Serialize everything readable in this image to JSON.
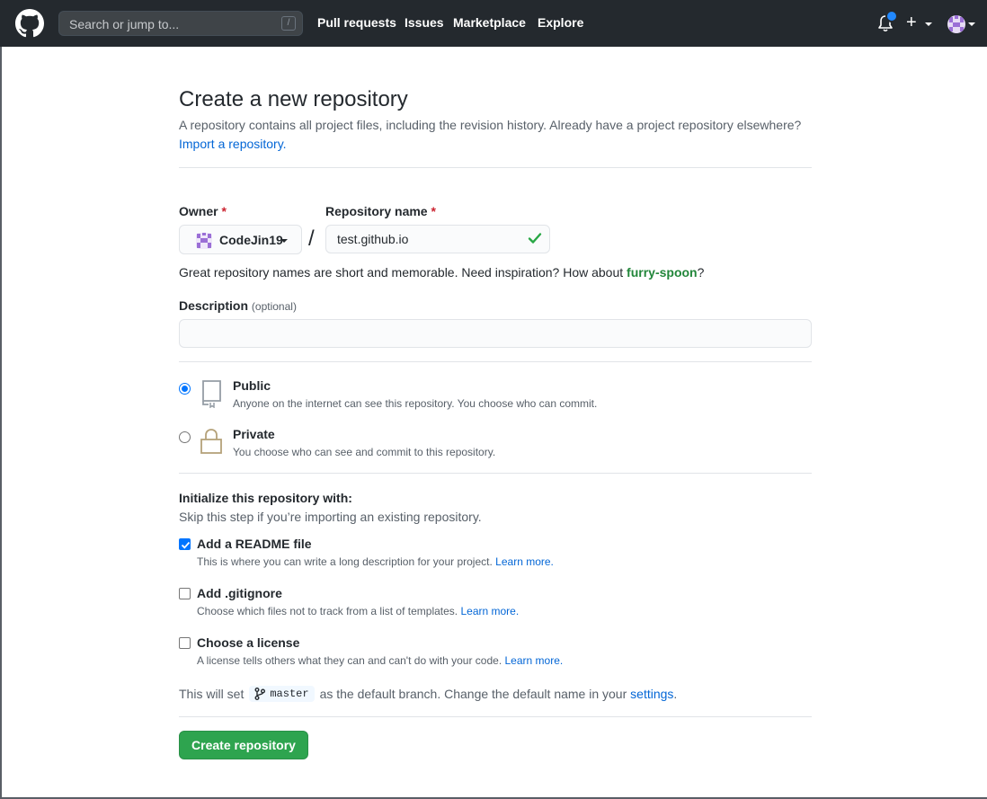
{
  "header": {
    "search_placeholder": "Search or jump to...",
    "search_shortcut": "/",
    "nav": [
      "Pull requests",
      "Issues",
      "Marketplace",
      "Explore"
    ],
    "plus_label": "+"
  },
  "page": {
    "title": "Create a new repository",
    "subtitle": "A repository contains all project files, including the revision history. Already have a project repository elsewhere?",
    "import_link": "Import a repository."
  },
  "form": {
    "owner_label": "Owner",
    "required_mark": "*",
    "owner_name": "CodeJin19",
    "repo_label": "Repository name",
    "separator": "/",
    "repo_value": "test.github.io",
    "hint_prefix": "Great repository names are short and memorable. Need inspiration? How about ",
    "hint_suggestion": "furry-spoon",
    "hint_suffix": "?",
    "description_label": "Description",
    "description_optional": "(optional)",
    "description_value": ""
  },
  "visibility": {
    "selected": "public",
    "public_title": "Public",
    "public_desc": "Anyone on the internet can see this repository. You choose who can commit.",
    "private_title": "Private",
    "private_desc": "You choose who can see and commit to this repository."
  },
  "init": {
    "title": "Initialize this repository with:",
    "subtitle": "Skip this step if you’re importing an existing repository.",
    "learn_more": "Learn more.",
    "readme_title": "Add a README file",
    "readme_desc": "This is where you can write a long description for your project.",
    "readme_checked": true,
    "gitignore_title": "Add .gitignore",
    "gitignore_desc": "Choose which files not to track from a list of templates.",
    "gitignore_checked": false,
    "license_title": "Choose a license",
    "license_desc": "A license tells others what they can and can't do with your code.",
    "license_checked": false
  },
  "branch": {
    "prefix": "This will set",
    "name": "master",
    "suffix": "as the default branch. Change the default name in your",
    "settings_link": "settings",
    "end": "."
  },
  "submit_label": "Create repository",
  "colors": {
    "header_bg": "#24292e",
    "link": "#0366d6",
    "primary_button": "#2ea44f",
    "required": "#cb2431",
    "suggestion": "#22863a",
    "notification_dot": "#2188ff"
  }
}
